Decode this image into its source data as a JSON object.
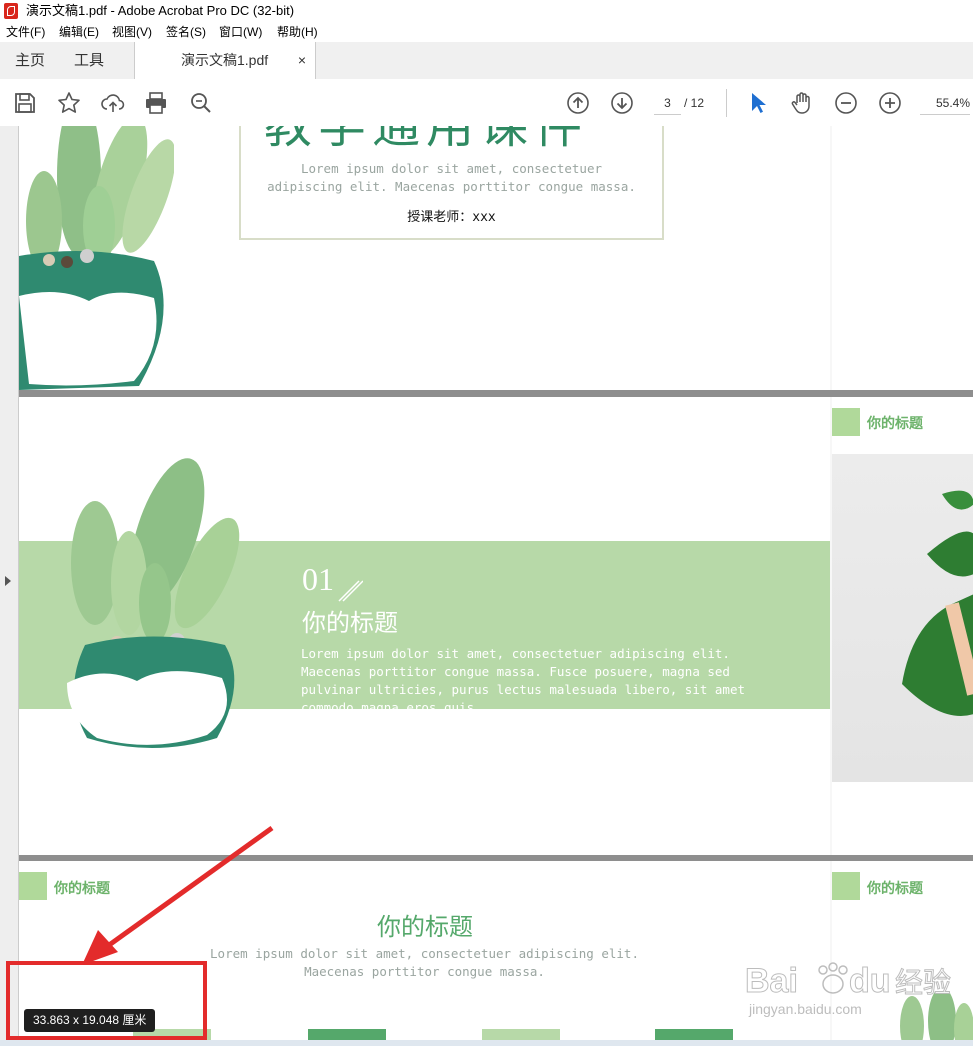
{
  "window": {
    "title": "演示文稿1.pdf - Adobe Acrobat Pro DC (32-bit)"
  },
  "menu": {
    "items": [
      "文件(F)",
      "编辑(E)",
      "视图(V)",
      "签名(S)",
      "窗口(W)",
      "帮助(H)"
    ]
  },
  "tabs": {
    "home": "主页",
    "tools": "工具",
    "document": "演示文稿1.pdf",
    "close": "×"
  },
  "toolbar": {
    "icons": [
      "save-icon",
      "bookmark-star-icon",
      "upload-icon",
      "print-icon",
      "zoom-search-icon",
      "prev-page-icon",
      "next-page-icon",
      "select-arrow-icon",
      "hand-icon",
      "zoom-out-icon",
      "zoom-in-icon"
    ],
    "current_page": "3",
    "total_pages": "/ 12",
    "zoom": "55.4%"
  },
  "page1": {
    "title_text": "教学通用课件",
    "lorem_line1": "Lorem ipsum dolor sit amet, consectetuer",
    "lorem_line2": "adipiscing elit. Maecenas porttitor congue massa.",
    "teacher": "授课老师：xxx"
  },
  "page2": {
    "number": "01",
    "title": "你的标题",
    "body_line1": "Lorem ipsum dolor sit amet, consectetuer adipiscing elit.",
    "body_line2": "Maecenas porttitor congue massa. Fusce posuere, magna sed",
    "body_line3": "pulvinar ultricies, purus lectus malesuada libero, sit amet",
    "body_line4": "commodo magna eros quis"
  },
  "page2_right": {
    "label": "你的标题"
  },
  "page3": {
    "label": "你的标题",
    "heading": "你的标题",
    "lorem_line1": "Lorem ipsum dolor sit amet, consectetuer adipiscing elit.",
    "lorem_line2": "Maecenas porttitor congue massa."
  },
  "page3_right": {
    "label": "你的标题"
  },
  "page_size_tooltip": "33.863 x 19.048 厘米",
  "watermark": {
    "brand": "Bai",
    "paw": "du",
    "tail": "经验",
    "url": "jingyan.baidu.com"
  },
  "colors": {
    "green_band": "#b7d9a8",
    "title_green": "#2f8a62",
    "label_green": "#6db36b",
    "annotation_red": "#e32b2b"
  }
}
